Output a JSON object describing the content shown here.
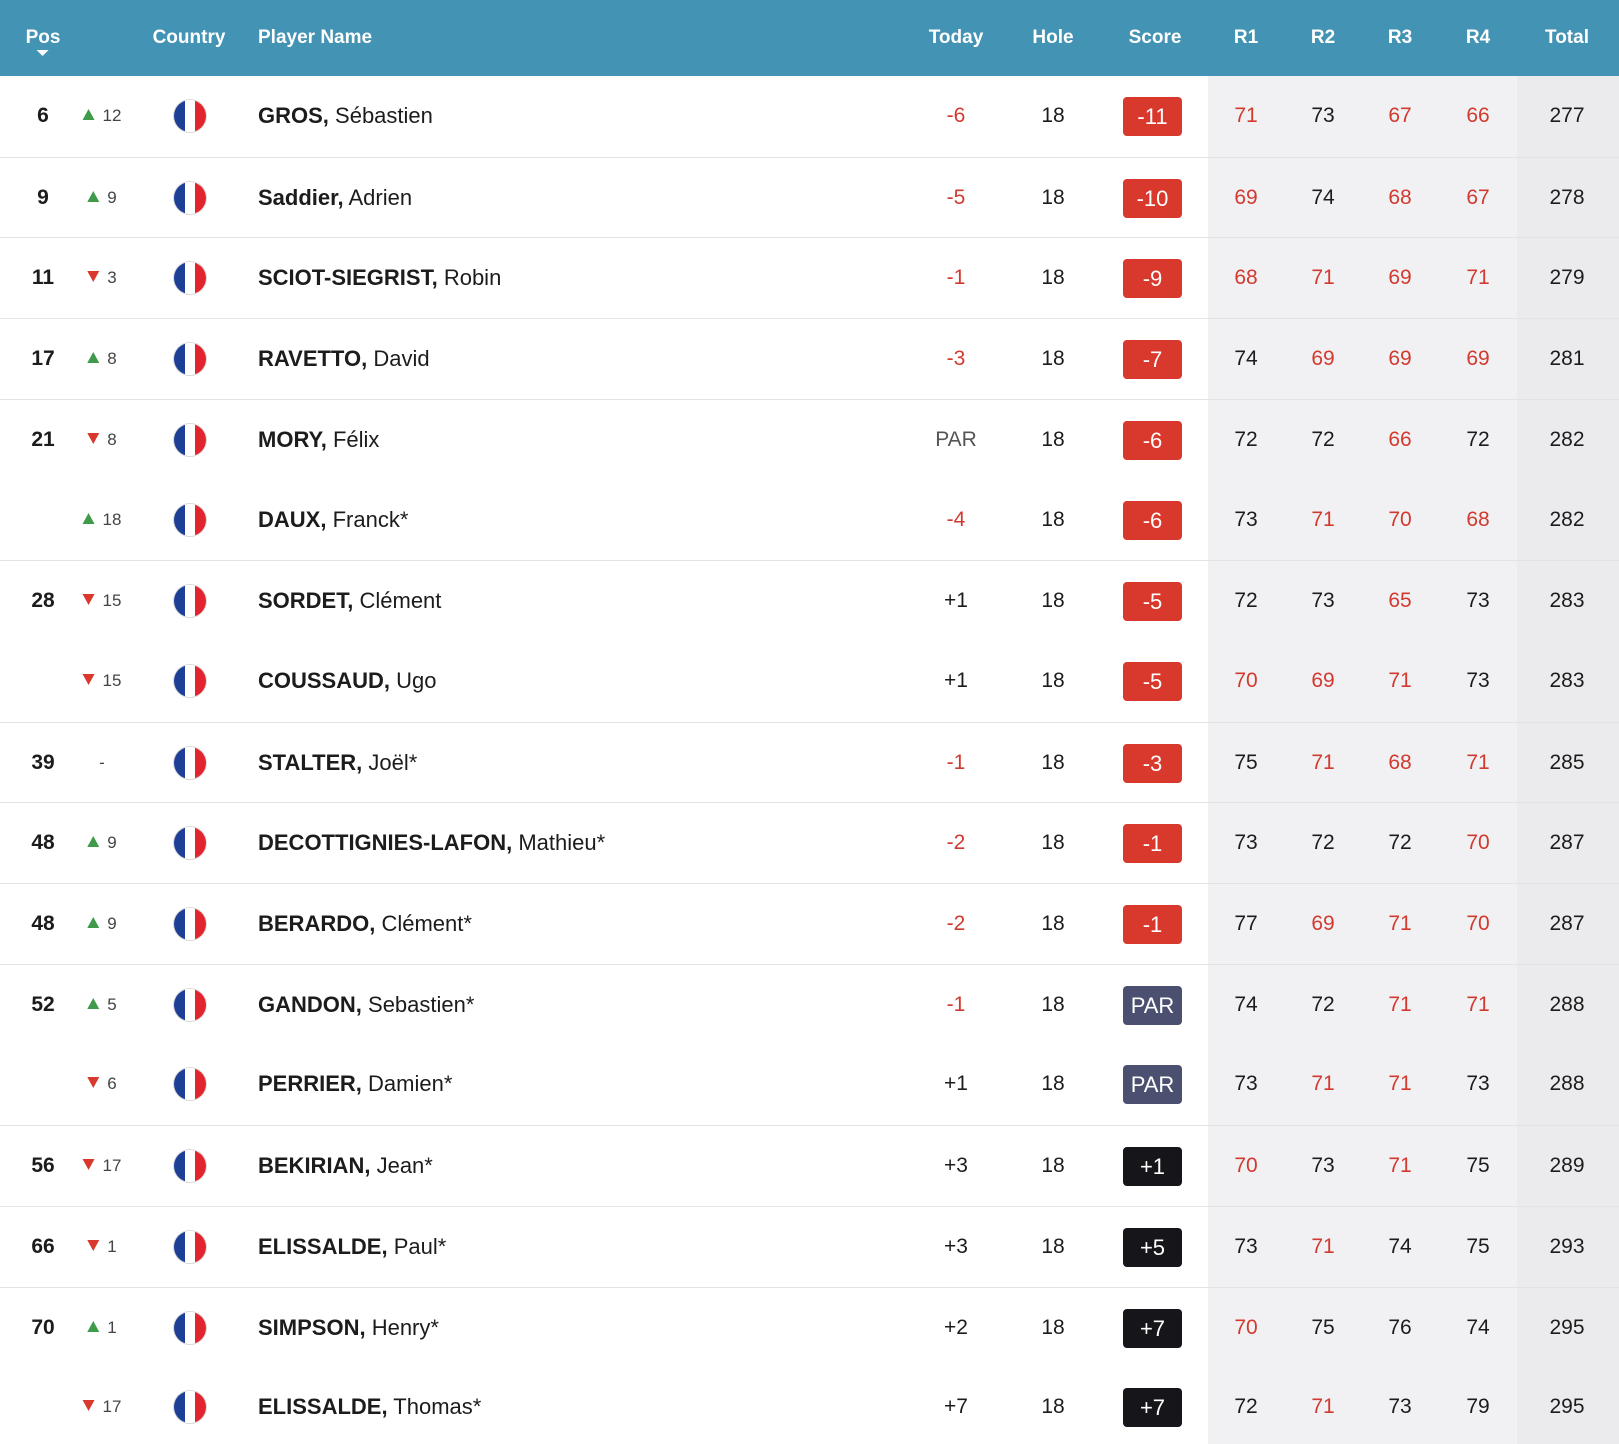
{
  "header": {
    "pos": "Pos",
    "country": "Country",
    "player_name": "Player Name",
    "today": "Today",
    "hole": "Hole",
    "score": "Score",
    "r1": "R1",
    "r2": "R2",
    "r3": "R3",
    "r4": "R4",
    "total": "Total"
  },
  "colors": {
    "header_bg": "#4393b5",
    "under_par": "#d9382c",
    "even_par": "#4b5070",
    "over_par": "#16161a",
    "move_up": "#3f9b4a",
    "move_down": "#d9382c"
  },
  "rows": [
    {
      "pos": "6",
      "move_dir": "up",
      "move": "12",
      "country": "France",
      "last": "GROS,",
      "first": "Sébastien",
      "today": "-6",
      "hole": "18",
      "score": "-11",
      "r1": "71",
      "r2": "73",
      "r3": "67",
      "r4": "66",
      "total": "277"
    },
    {
      "pos": "9",
      "move_dir": "up",
      "move": "9",
      "country": "France",
      "last": "Saddier,",
      "first": "Adrien",
      "today": "-5",
      "hole": "18",
      "score": "-10",
      "r1": "69",
      "r2": "74",
      "r3": "68",
      "r4": "67",
      "total": "278"
    },
    {
      "pos": "11",
      "move_dir": "down",
      "move": "3",
      "country": "France",
      "last": "SCIOT-SIEGRIST,",
      "first": "Robin",
      "today": "-1",
      "hole": "18",
      "score": "-9",
      "r1": "68",
      "r2": "71",
      "r3": "69",
      "r4": "71",
      "total": "279"
    },
    {
      "pos": "17",
      "move_dir": "up",
      "move": "8",
      "country": "France",
      "last": "RAVETTO,",
      "first": "David",
      "today": "-3",
      "hole": "18",
      "score": "-7",
      "r1": "74",
      "r2": "69",
      "r3": "69",
      "r4": "69",
      "total": "281"
    },
    {
      "pos": "21",
      "move_dir": "down",
      "move": "8",
      "country": "France",
      "last": "MORY,",
      "first": "Félix",
      "today": "PAR",
      "hole": "18",
      "score": "-6",
      "r1": "72",
      "r2": "72",
      "r3": "66",
      "r4": "72",
      "total": "282"
    },
    {
      "pos": "",
      "move_dir": "up",
      "move": "18",
      "country": "France",
      "last": "DAUX,",
      "first": "Franck*",
      "today": "-4",
      "hole": "18",
      "score": "-6",
      "r1": "73",
      "r2": "71",
      "r3": "70",
      "r4": "68",
      "total": "282"
    },
    {
      "pos": "28",
      "move_dir": "down",
      "move": "15",
      "country": "France",
      "last": "SORDET,",
      "first": "Clément",
      "today": "+1",
      "hole": "18",
      "score": "-5",
      "r1": "72",
      "r2": "73",
      "r3": "65",
      "r4": "73",
      "total": "283"
    },
    {
      "pos": "",
      "move_dir": "down",
      "move": "15",
      "country": "France",
      "last": "COUSSAUD,",
      "first": "Ugo",
      "today": "+1",
      "hole": "18",
      "score": "-5",
      "r1": "70",
      "r2": "69",
      "r3": "71",
      "r4": "73",
      "total": "283"
    },
    {
      "pos": "39",
      "move_dir": "none",
      "move": "-",
      "country": "France",
      "last": "STALTER,",
      "first": "Joël*",
      "today": "-1",
      "hole": "18",
      "score": "-3",
      "r1": "75",
      "r2": "71",
      "r3": "68",
      "r4": "71",
      "total": "285"
    },
    {
      "pos": "48",
      "move_dir": "up",
      "move": "9",
      "country": "France",
      "last": "DECOTTIGNIES-LAFON,",
      "first": "Mathieu*",
      "today": "-2",
      "hole": "18",
      "score": "-1",
      "r1": "73",
      "r2": "72",
      "r3": "72",
      "r4": "70",
      "total": "287"
    },
    {
      "pos": "48",
      "move_dir": "up",
      "move": "9",
      "country": "France",
      "last": "BERARDO,",
      "first": "Clément*",
      "today": "-2",
      "hole": "18",
      "score": "-1",
      "r1": "77",
      "r2": "69",
      "r3": "71",
      "r4": "70",
      "total": "287"
    },
    {
      "pos": "52",
      "move_dir": "up",
      "move": "5",
      "country": "France",
      "last": "GANDON,",
      "first": "Sebastien*",
      "today": "-1",
      "hole": "18",
      "score": "PAR",
      "r1": "74",
      "r2": "72",
      "r3": "71",
      "r4": "71",
      "total": "288"
    },
    {
      "pos": "",
      "move_dir": "down",
      "move": "6",
      "country": "France",
      "last": "PERRIER,",
      "first": "Damien*",
      "today": "+1",
      "hole": "18",
      "score": "PAR",
      "r1": "73",
      "r2": "71",
      "r3": "71",
      "r4": "73",
      "total": "288"
    },
    {
      "pos": "56",
      "move_dir": "down",
      "move": "17",
      "country": "France",
      "last": "BEKIRIAN,",
      "first": "Jean*",
      "today": "+3",
      "hole": "18",
      "score": "+1",
      "r1": "70",
      "r2": "73",
      "r3": "71",
      "r4": "75",
      "total": "289"
    },
    {
      "pos": "66",
      "move_dir": "down",
      "move": "1",
      "country": "France",
      "last": "ELISSALDE,",
      "first": "Paul*",
      "today": "+3",
      "hole": "18",
      "score": "+5",
      "r1": "73",
      "r2": "71",
      "r3": "74",
      "r4": "75",
      "total": "293"
    },
    {
      "pos": "70",
      "move_dir": "up",
      "move": "1",
      "country": "France",
      "last": "SIMPSON,",
      "first": "Henry*",
      "today": "+2",
      "hole": "18",
      "score": "+7",
      "r1": "70",
      "r2": "75",
      "r3": "76",
      "r4": "74",
      "total": "295"
    },
    {
      "pos": "",
      "move_dir": "down",
      "move": "17",
      "country": "France",
      "last": "ELISSALDE,",
      "first": "Thomas*",
      "today": "+7",
      "hole": "18",
      "score": "+7",
      "r1": "72",
      "r2": "71",
      "r3": "73",
      "r4": "79",
      "total": "295"
    }
  ]
}
